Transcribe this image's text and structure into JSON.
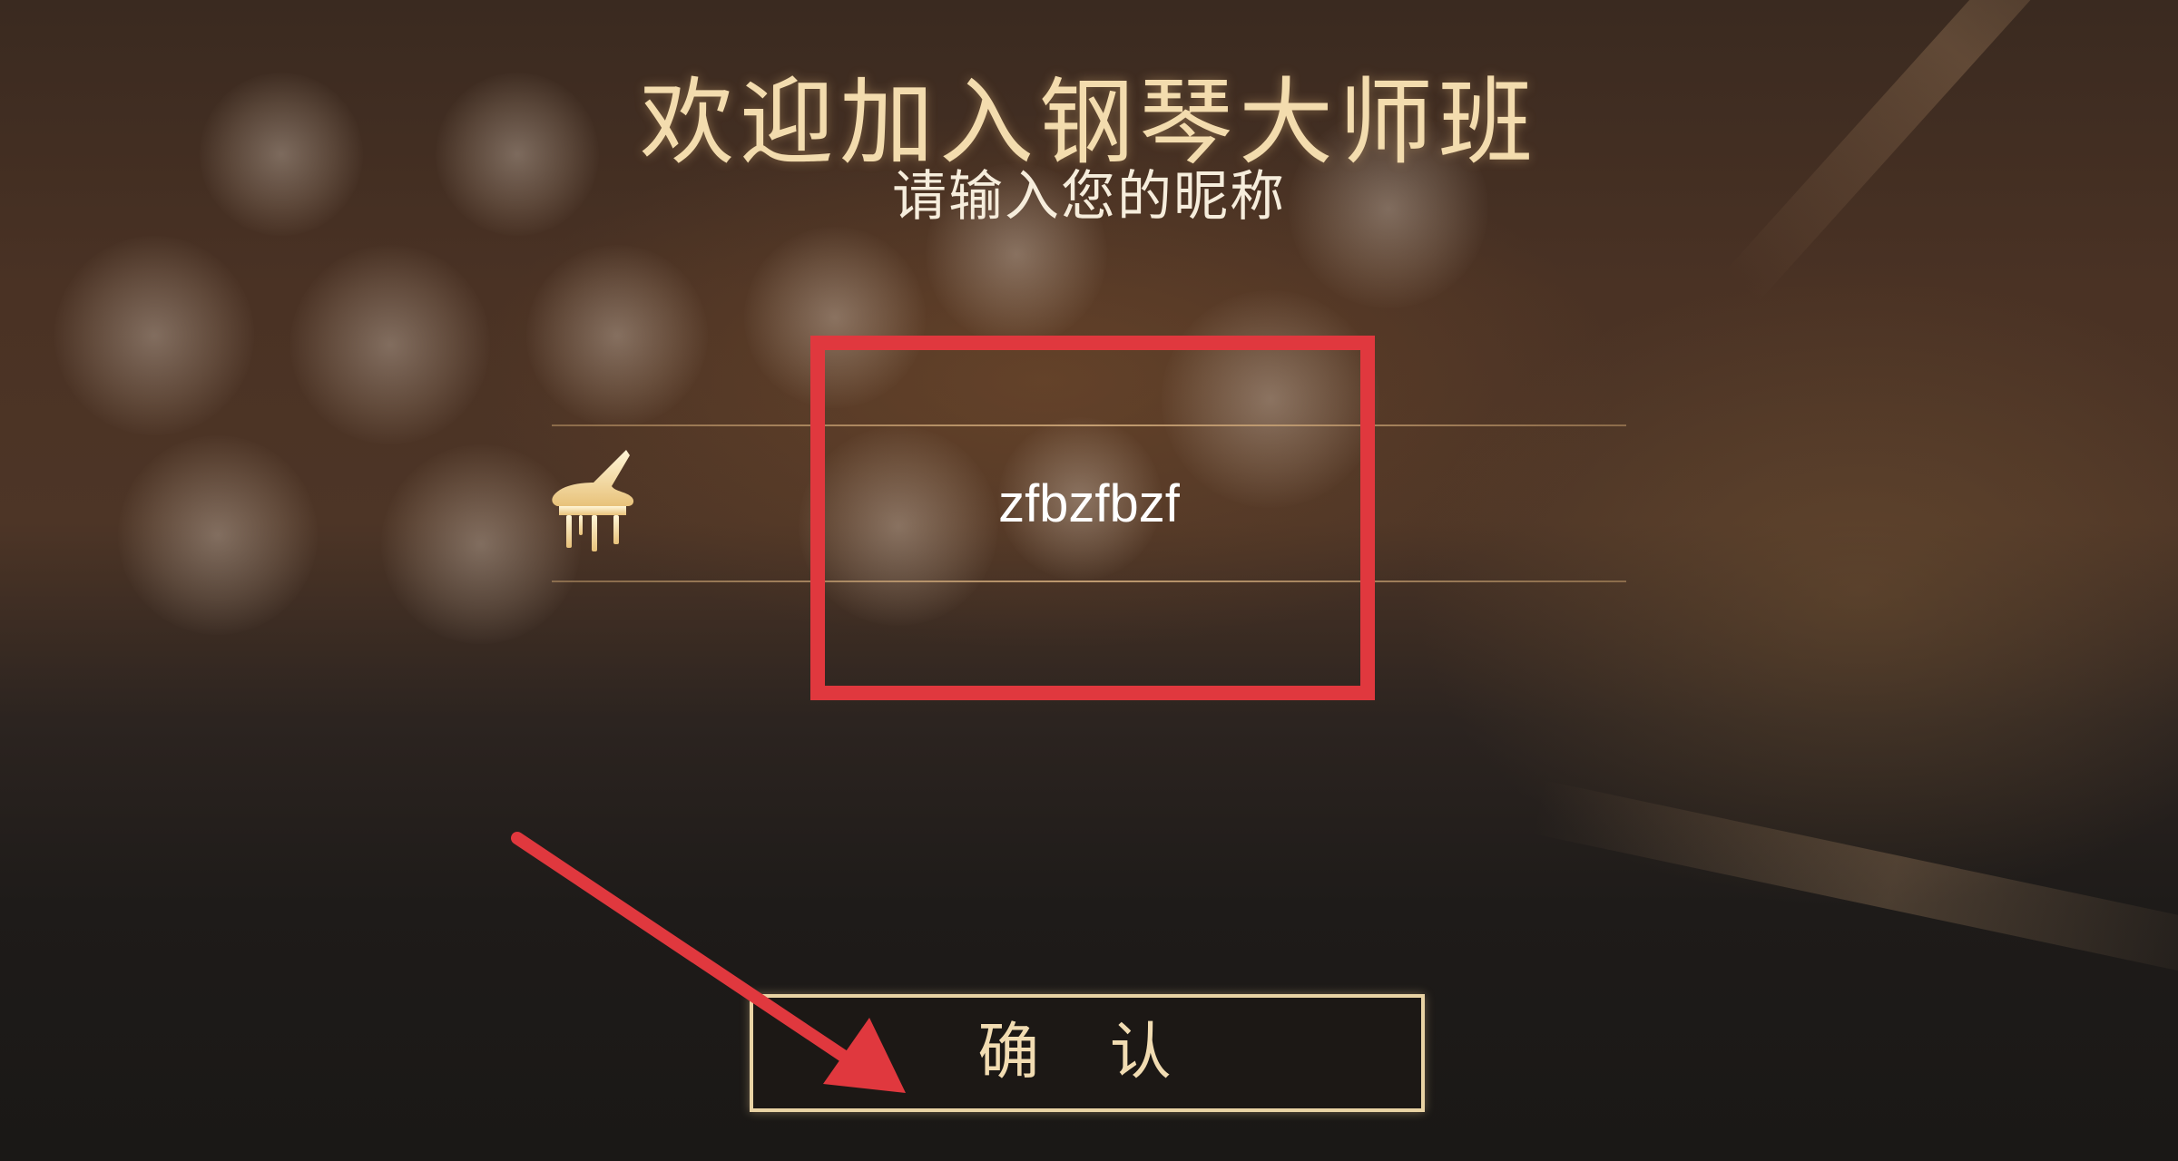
{
  "welcome": {
    "title": "欢迎加入钢琴大师班",
    "subtitle": "请输入您的昵称"
  },
  "nickname": {
    "value": "zfbzfbzf"
  },
  "confirm": {
    "label": "确 认"
  },
  "icons": {
    "piano": "grand-piano-icon"
  },
  "colors": {
    "gold": "#f3dcae",
    "highlight_red": "#e0383e",
    "button_border": "#e9d3a4"
  }
}
